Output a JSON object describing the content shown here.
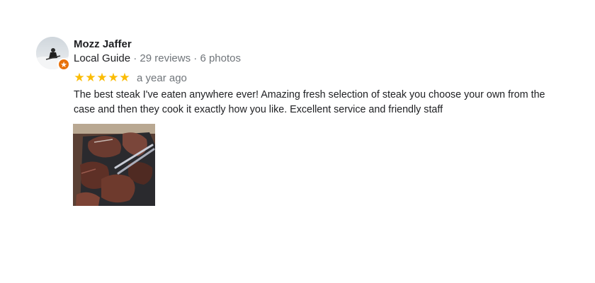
{
  "review": {
    "author": {
      "name": "Mozz Jaffer",
      "avatar_icon": "user-avatar-photo",
      "badge_icon": "local-guide-star-icon",
      "badge_color": "#e8710a"
    },
    "meta": {
      "level": "Local Guide",
      "separator": " · ",
      "reviews_count": "29 reviews",
      "photos_count": "6 photos"
    },
    "rating": {
      "stars": 5,
      "max_stars": 5,
      "star_color": "#fbbc04",
      "time": "a year ago"
    },
    "text": "The best steak I've eaten anywhere ever! Amazing fresh selection of steak you choose your own from the case and then they cook it exactly how you like. Excellent service and friendly staff",
    "photos": [
      {
        "icon": "steak-photo-thumbnail"
      }
    ]
  }
}
